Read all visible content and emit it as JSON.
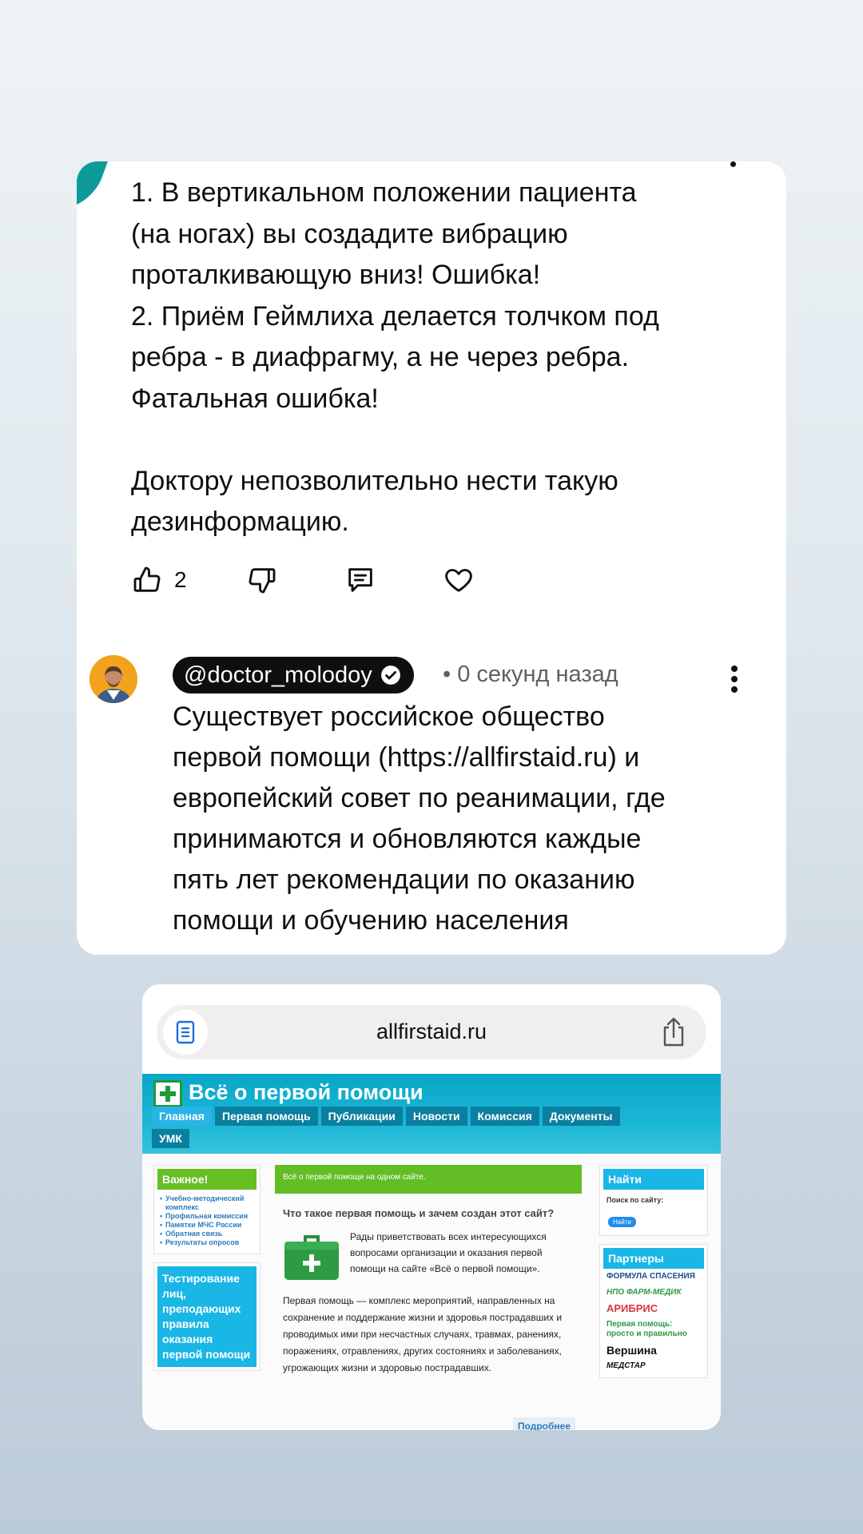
{
  "comment": {
    "text": "1. В вертикальном положении пациента\n(на ногах) вы создадите вибрацию\nпроталкивающую вниз! Ошибка!\n2. Приём Геймлиха делается толчком под\nребра - в диафрагму, а не через ребра.\nФатальная ошибка!\n\nДоктору непозволительно нести такую\nдезинформацию.",
    "likes": "2",
    "icons": [
      "thumbs-up-icon",
      "thumbs-down-icon",
      "reply-icon",
      "heart-icon"
    ]
  },
  "reply": {
    "author": "@doctor_molodoy",
    "time": "• 0 секунд назад",
    "text": "Существует российское общество\nпервой помощи (https://allfirstaid.ru) и\nевропейский совет по реанимации, где\nпринимаются и обновляются каждые\nпять лет рекомендации по оказанию\nпомощи и обучению населения"
  },
  "browser": {
    "url": "allfirstaid.ru"
  },
  "site": {
    "title": "Всё о первой помощи",
    "nav": [
      "Главная",
      "Первая помощь",
      "Публикации",
      "Новости",
      "Комиссия",
      "Документы",
      "УМК"
    ],
    "important_title": "Важное!",
    "important_items": [
      "Учебно-методический комплекс",
      "Профильная комиссия",
      "Памятки МЧС России",
      "Обратная связь",
      "Результаты опросов"
    ],
    "testing": "Тестирование лиц, преподающих правила оказания первой помощи",
    "banner": "Всё о первой помощи на одном сайте.",
    "article_title": "Что такое первая помощь и зачем создан этот сайт?",
    "article_p1": "Рады приветствовать всех интересующихся вопросами организации и оказания первой помощи на сайте «Всё о первой помощи».",
    "article_p2": "Первая помощь — комплекс мероприятий, направленных на сохранение и поддержание жизни и здоровья пострадавших и проводимых ими при несчастных случаях, травмах, ранениях, поражениях, отравлениях, других состояниях и заболеваниях, угрожающих жизни и здоровью пострадавших.",
    "more": "Подробнее",
    "find_title": "Найти",
    "search_label": "Поиск по сайту:",
    "search_btn": "Найти",
    "partners_title": "Партнеры",
    "partners": [
      "ФОРМУЛА СПАСЕНИЯ",
      "НПО ФАРМ-МЕДИК",
      "АРИБРИС",
      "Первая помощь: просто и правильно",
      "Вершина",
      "МЕДСТАР"
    ]
  },
  "colors": {
    "teal_accent": "#0e9a9b",
    "site_blue": "#0aa6c9",
    "site_green": "#63bd24"
  }
}
